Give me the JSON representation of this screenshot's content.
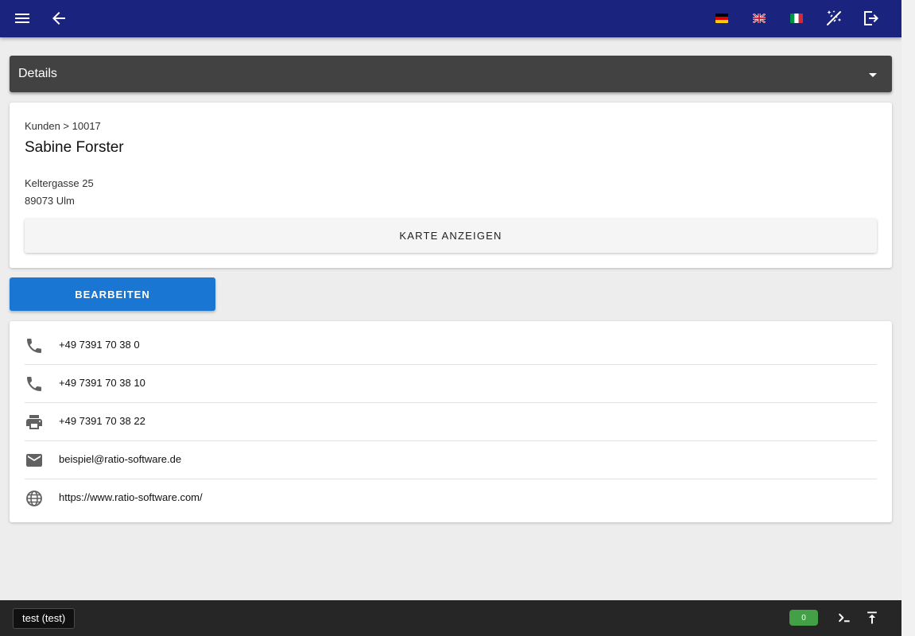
{
  "appbar": {
    "background": "#1a237e",
    "icons": [
      "menu-icon",
      "arrow-back-icon",
      "flag-de-icon",
      "flag-gb-icon",
      "flag-it-icon",
      "auto-fix-icon",
      "logout-icon"
    ]
  },
  "details": {
    "title": "Details",
    "toggle_icon": "arrow-drop-down-icon"
  },
  "customer": {
    "breadcrumb": "Kunden > 10017",
    "name": "Sabine Forster",
    "street": "Keltergasse 25",
    "city": "89073 Ulm",
    "map_button": "KARTE ANZEIGEN"
  },
  "edit_button": "BEARBEITEN",
  "contacts": [
    {
      "icon": "phone-icon",
      "value": "+49 7391 70 38 0"
    },
    {
      "icon": "phone-icon",
      "value": "+49 7391 70 38 10"
    },
    {
      "icon": "printer-icon",
      "value": "+49 7391 70 38 22"
    },
    {
      "icon": "email-icon",
      "value": "beispiel@ratio-software.de"
    },
    {
      "icon": "web-icon",
      "value": "https://www.ratio-software.com/"
    }
  ],
  "footer": {
    "user": "test (test)",
    "count": "0",
    "count_color": "#43a047",
    "icons": [
      "console-icon",
      "scroll-top-icon"
    ]
  },
  "colors": {
    "primary": "#1a237e",
    "accent": "#1976d2",
    "header_dark": "#424242",
    "footer": "#262626"
  }
}
